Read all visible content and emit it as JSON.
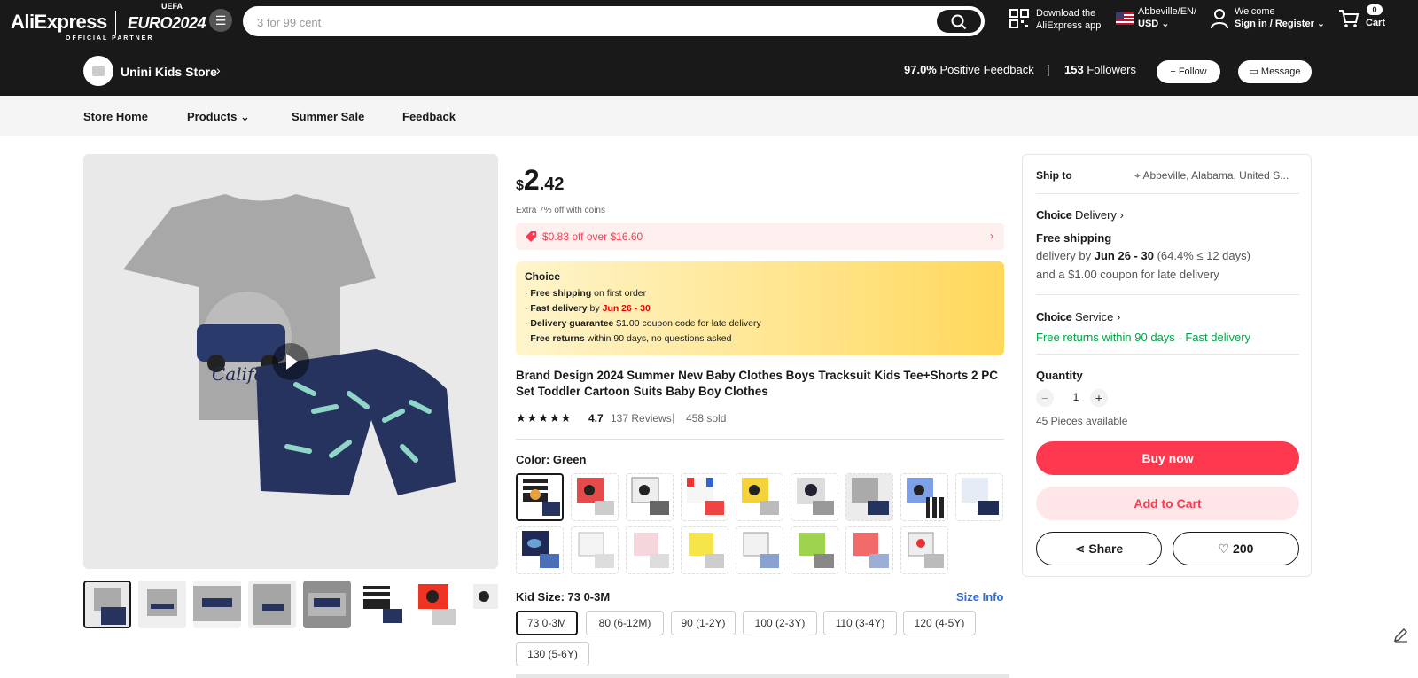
{
  "header": {
    "logo_text": "AliExpress",
    "euro_text": "EURO2024",
    "uefa_text": "UEFA",
    "partner_text": "OFFICIAL PARTNER",
    "search_placeholder": "3 for 99 cent",
    "download_line1": "Download the",
    "download_line2": "AliExpress app",
    "location_line": "Abbeville/EN/",
    "currency": "USD",
    "welcome": "Welcome",
    "signin": "Sign in / Register",
    "cart_count": "0",
    "cart_label": "Cart"
  },
  "store": {
    "name": "Unini Kids Store",
    "feedback_pct": "97.0%",
    "feedback_label": "Positive Feedback",
    "separator": "|",
    "followers_count": "153",
    "followers_label": "Followers",
    "follow_label": "+ Follow",
    "message_label": "Message"
  },
  "subnav": [
    "Store Home",
    "Products",
    "Summer Sale",
    "Feedback"
  ],
  "product": {
    "currency": "$",
    "price_int": "2",
    "price_dec": ".42",
    "coins_note": "Extra 7% off with coins",
    "coupon": "$0.83 off over $16.60",
    "choice_title": "Choice",
    "choice_lines": [
      {
        "b": "Free shipping",
        "t": " on first order"
      },
      {
        "b": "Fast delivery",
        "t": " by ",
        "r": "Jun 26 - 30"
      },
      {
        "b": "Delivery guarantee",
        "t": "  $1.00 coupon code for late delivery"
      },
      {
        "b": "Free returns",
        "t": "  within 90 days, no questions asked"
      }
    ],
    "title": "Brand Design 2024 Summer New Baby Clothes Boys Tracksuit Kids Tee+Shorts 2 PC Set Toddler Cartoon Suits Baby Boy Clothes",
    "rating": "4.7",
    "reviews": "137 Reviews",
    "rating_sep": "|",
    "sold": "458 sold",
    "color_label": "Color: Green",
    "size_label": "Kid Size: 73 0-3M",
    "size_info": "Size Info",
    "sizes": [
      "73 0-3M",
      "80 (6-12M)",
      "90 (1-2Y)",
      "100 (2-3Y)",
      "110 (3-4Y)",
      "120 (4-5Y)",
      "130 (5-6Y)"
    ]
  },
  "panel": {
    "ship_to": "Ship to",
    "location": "Abbeville, Alabama, United S...",
    "choice_delivery": [
      "Choice",
      " Delivery"
    ],
    "free_shipping": "Free shipping",
    "delivery_prefix": "delivery by ",
    "delivery_date": "Jun 26 - 30",
    "delivery_suffix": " (64.4% ≤ 12 days)",
    "late_coupon": "and a $1.00 coupon for late delivery",
    "choice_service": [
      "Choice",
      " Service"
    ],
    "service_text": "Free returns within 90 days · Fast delivery",
    "quantity_label": "Quantity",
    "quantity_value": "1",
    "available": "45 Pieces available",
    "buy_now": "Buy now",
    "add_to_cart": "Add to Cart",
    "share": "Share",
    "wishlist_count": "200"
  },
  "colors": {
    "accent": "#fd384f",
    "choice_yellow": "#ffe48a",
    "link_blue": "#2e6ad8",
    "success": "#00a645",
    "topbar": "#191919"
  }
}
